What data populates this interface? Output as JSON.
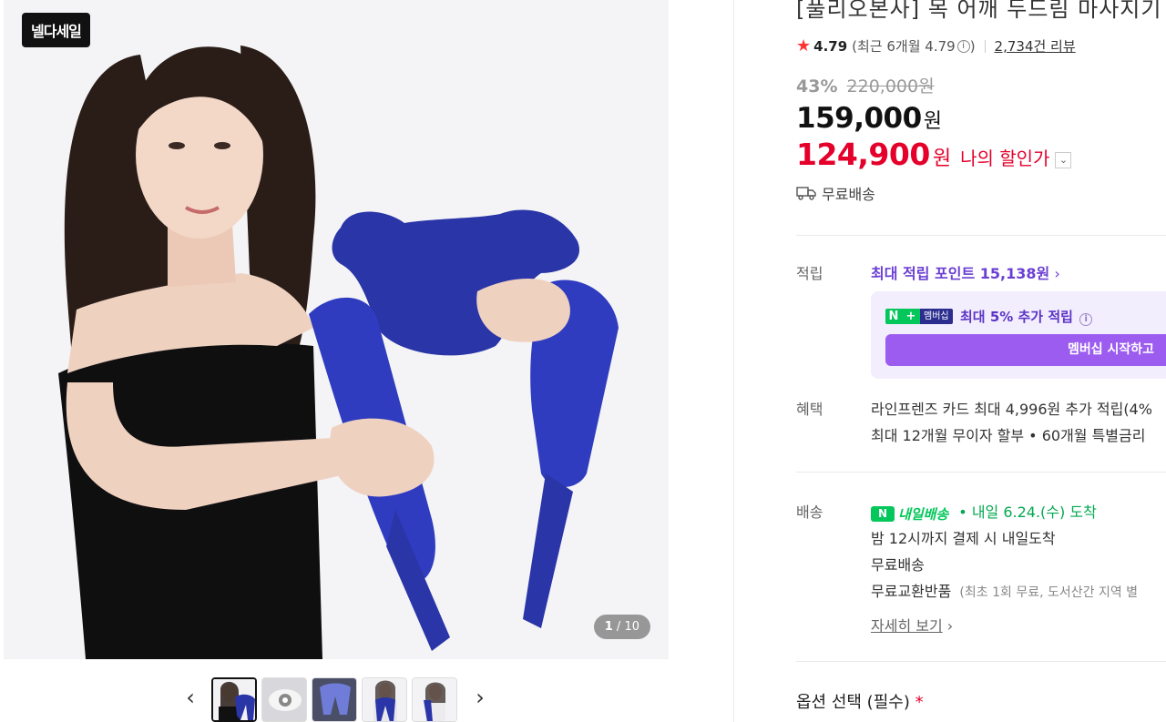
{
  "gallery": {
    "badge": "넬다세일",
    "counter_current": "1",
    "counter_total": "10",
    "prev_arrow": "‹",
    "next_arrow": "›",
    "thumbnail_count": 5
  },
  "product": {
    "title": "[풀리오본사] 목 어깨 두드림 마사지기",
    "rating": "4.79",
    "rating_recent": "(최근 6개월 4.79",
    "rating_close": ")",
    "review_count": "2,734건 리뷰",
    "discount_pct": "43%",
    "original_price": "220,000원",
    "price": "159,000",
    "price_unit": "원",
    "my_price": "124,900",
    "my_price_unit": "원",
    "my_price_label": "나의 할인가",
    "free_shipping": "무료배송"
  },
  "points": {
    "label": "적립",
    "max_points": "최대 적립 포인트 15,138원",
    "nplus_n": "N",
    "nplus_plus": "+",
    "nplus_membership": "멤버십",
    "nplus_text": "최대 5% 추가 적립",
    "member_button": "멤버십 시작하고"
  },
  "benefits": {
    "label": "혜택",
    "line1": "라인프렌즈 카드 최대 4,996원 추가 적립(4%",
    "line2": "최대 12개월 무이자 할부 • 60개월 특별금리"
  },
  "delivery": {
    "label": "배송",
    "badge_icon": "N",
    "badge_text": "내일배송",
    "eta": "• 내일 6.24.(수) 도착",
    "cutoff": "밤 12시까지 결제 시 내일도착",
    "free": "무료배송",
    "exchange": "무료교환반품",
    "exchange_note": "(최초 1회 무료, 도서산간 지역 별",
    "details_link": "자세히 보기"
  },
  "options": {
    "label": "옵션 선택 (필수)",
    "required_mark": "*"
  },
  "colors": {
    "sale_red": "#e4002b",
    "naver_green": "#03c75a",
    "points_purple": "#6b3fd4",
    "member_button": "#9c5cf0",
    "product_blue": "#2a35a8"
  }
}
